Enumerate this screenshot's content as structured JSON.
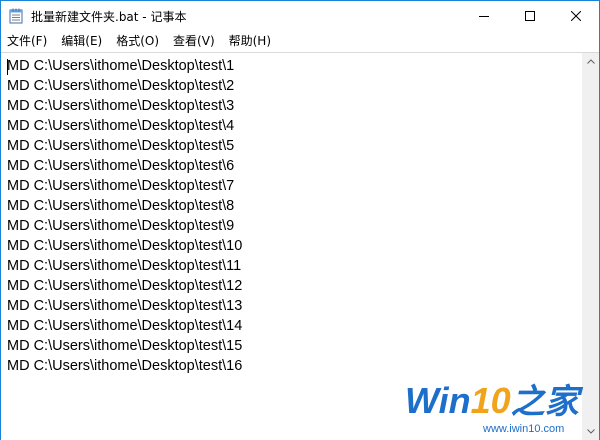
{
  "window": {
    "title": "批量新建文件夹.bat - 记事本",
    "border_color": "#1883d7"
  },
  "menu": {
    "items": [
      "文件(F)",
      "编辑(E)",
      "格式(O)",
      "查看(V)",
      "帮助(H)"
    ]
  },
  "editor": {
    "lines": [
      "MD C:\\Users\\ithome\\Desktop\\test\\1",
      "MD C:\\Users\\ithome\\Desktop\\test\\2",
      "MD C:\\Users\\ithome\\Desktop\\test\\3",
      "MD C:\\Users\\ithome\\Desktop\\test\\4",
      "MD C:\\Users\\ithome\\Desktop\\test\\5",
      "MD C:\\Users\\ithome\\Desktop\\test\\6",
      "MD C:\\Users\\ithome\\Desktop\\test\\7",
      "MD C:\\Users\\ithome\\Desktop\\test\\8",
      "MD C:\\Users\\ithome\\Desktop\\test\\9",
      "MD C:\\Users\\ithome\\Desktop\\test\\10",
      "MD C:\\Users\\ithome\\Desktop\\test\\11",
      "MD C:\\Users\\ithome\\Desktop\\test\\12",
      "MD C:\\Users\\ithome\\Desktop\\test\\13",
      "MD C:\\Users\\ithome\\Desktop\\test\\14",
      "MD C:\\Users\\ithome\\Desktop\\test\\15",
      "MD C:\\Users\\ithome\\Desktop\\test\\16"
    ]
  },
  "watermark": {
    "brand_win": "Win",
    "brand_ten": "10",
    "brand_suffix": "之家",
    "url": "www.iwin10.com",
    "brand_blue": "#1d6fc9",
    "brand_orange": "#f0a31b"
  },
  "icons": {
    "app": "notepad-icon",
    "minimize": "minimize-icon",
    "maximize": "maximize-icon",
    "close": "close-icon",
    "scroll_up": "scroll-up-arrow-icon",
    "scroll_down": "scroll-down-arrow-icon"
  }
}
